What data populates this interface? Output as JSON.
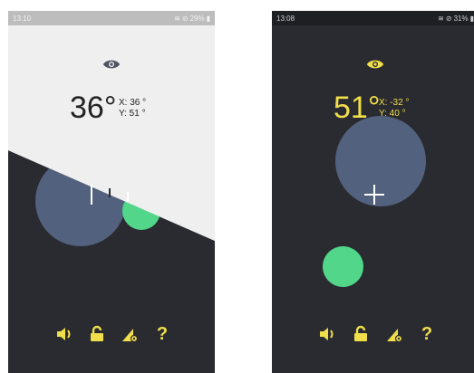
{
  "colors": {
    "accent_yellow": "#f0de4a",
    "dark_bg": "#2a2b30",
    "light_bg": "#efefef",
    "eye_gray": "#4b5563",
    "bubble_blue": "#52617d",
    "bubble_green": "#52d68a"
  },
  "left_screen": {
    "status_time": "13:10",
    "status_battery": "29%",
    "angle": "36°",
    "x_reading": "X: 36 °",
    "y_reading": "Y: 51 °",
    "eye_icon": "eye-icon"
  },
  "right_screen": {
    "status_time": "13:08",
    "status_battery": "31%",
    "angle": "51°",
    "x_reading": "X: -32 °",
    "y_reading": "Y: 40 °",
    "eye_icon": "eye-icon"
  },
  "controls": {
    "icons": [
      "speaker-icon",
      "unlock-icon",
      "angle-settings-icon",
      "help-icon"
    ],
    "help_label": "?"
  }
}
